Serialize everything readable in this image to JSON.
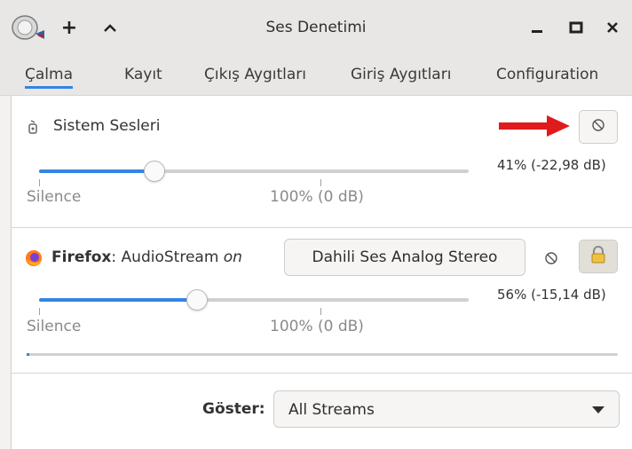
{
  "window": {
    "title": "Ses Denetimi",
    "app_icon": "speaker-app-icon",
    "buttons": {
      "new": "+",
      "up": "^",
      "minimize": "_",
      "maximize": "maximize-icon",
      "close": "✕"
    }
  },
  "tabs": [
    {
      "label": "Çalma",
      "active": true
    },
    {
      "label": "Kayıt",
      "active": false
    },
    {
      "label": "Çıkış Aygıtları",
      "active": false
    },
    {
      "label": "Giriş Aygıtları",
      "active": false
    },
    {
      "label": "Configuration",
      "active": false
    }
  ],
  "streams": [
    {
      "name": "Sistem Sesleri",
      "icon": "system-sounds-icon",
      "volume_label": "41% (-22,98 dB)",
      "volume_fraction": 0.41,
      "scale_min": "Silence",
      "scale_mid": "100% (0 dB)",
      "mute_icon": "mute-icon",
      "annotation_arrow": "red-arrow"
    },
    {
      "app": "Firefox",
      "separator": ": ",
      "stream": "AudioStream",
      "on_text": "on",
      "device": "Dahili Ses Analog Stereo",
      "volume_label": "56% (-15,14 dB)",
      "volume_fraction": 0.56,
      "scale_min": "Silence",
      "scale_mid": "100% (0 dB)",
      "mute_icon": "mute-icon",
      "lock_icon": "lock-icon",
      "level_fraction": 0.005
    }
  ],
  "footer": {
    "show_label": "Göster:",
    "filter_value": "All Streams"
  },
  "colors": {
    "accent": "#3584e4",
    "arrow": "#e01b1b",
    "lock": "#f0c040"
  }
}
